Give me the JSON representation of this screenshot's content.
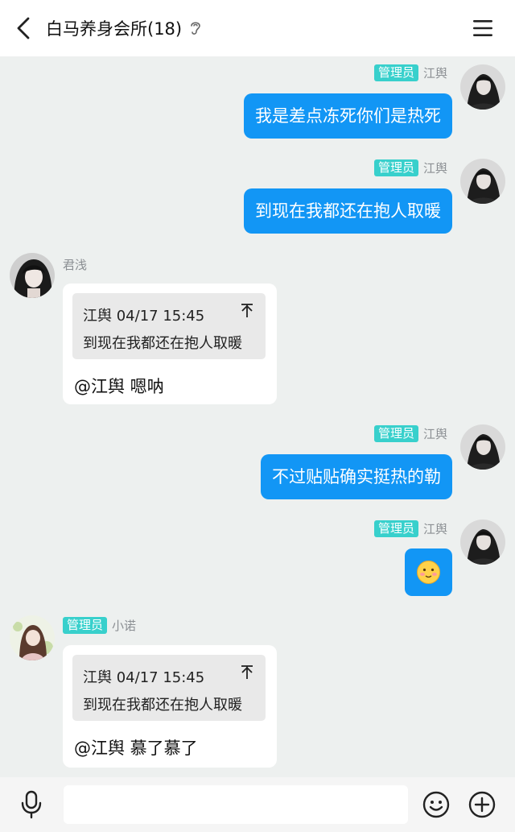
{
  "header": {
    "title": "白马养身会所(18)",
    "icons": {
      "back": "back-chevron-icon",
      "ear": "ear-icon",
      "menu": "menu-icon"
    }
  },
  "messages": [
    {
      "side": "right",
      "badge": "管理员",
      "name": "江舆",
      "text": "我是差点冻死你们是热死",
      "avatar": "jiangyu-avatar"
    },
    {
      "side": "right",
      "badge": "管理员",
      "name": "江舆",
      "text": "到现在我都还在抱人取暖",
      "avatar": "jiangyu-avatar"
    },
    {
      "side": "left",
      "badge": "",
      "name": "君浅",
      "quote_head": "江舆 04/17 15:45",
      "quote_text": "到现在我都还在抱人取暖",
      "reply": "@江舆 嗯呐",
      "avatar": "junqian-avatar"
    },
    {
      "side": "right",
      "badge": "管理员",
      "name": "江舆",
      "text": "不过贴贴确实挺热的勒",
      "avatar": "jiangyu-avatar"
    },
    {
      "side": "right",
      "badge": "管理员",
      "name": "江舆",
      "sticker": "blush-face-emoji",
      "avatar": "jiangyu-avatar"
    },
    {
      "side": "left",
      "badge": "管理员",
      "name": "小诺",
      "quote_head": "江舆 04/17 15:45",
      "quote_text": "到现在我都还在抱人取暖",
      "reply": "@江舆 慕了慕了",
      "avatar": "xiaonuo-avatar"
    }
  ],
  "input_bar": {
    "placeholder": "",
    "icons": {
      "voice": "microphone-icon",
      "emoji": "smiley-icon",
      "more": "plus-circle-icon"
    }
  },
  "colors": {
    "background": "#edf0ef",
    "bubble_blue": "#1296f5",
    "admin_badge": "#38d0cc",
    "name_gray": "#8b8f93"
  }
}
